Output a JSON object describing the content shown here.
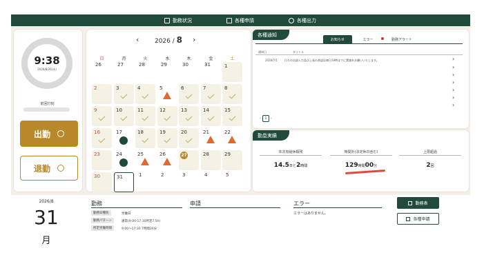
{
  "nav": {
    "items": [
      {
        "label": "勤務状況",
        "icon": "calendar-icon"
      },
      {
        "label": "各種申請",
        "icon": "document-icon"
      },
      {
        "label": "各種出力",
        "icon": "cloud-download-icon"
      }
    ]
  },
  "clock": {
    "time": "9:38",
    "date": "2026/8/26(水)"
  },
  "punch": {
    "last_label": "前回打刻",
    "in_label": "出勤",
    "out_label": "退勤"
  },
  "calendar": {
    "year_prefix": "2026 /",
    "month": "8",
    "weekdays": [
      "日",
      "月",
      "火",
      "水",
      "木",
      "金",
      "土"
    ],
    "rows": [
      [
        "26",
        "27",
        "28",
        "29",
        "30",
        "31",
        "1"
      ],
      [
        "2",
        "3",
        "4",
        "5",
        "6",
        "7",
        "8"
      ],
      [
        "9",
        "10",
        "11",
        "12",
        "13",
        "14",
        "15"
      ],
      [
        "16",
        "17",
        "18",
        "19",
        "20",
        "21",
        "22"
      ],
      [
        "23",
        "24",
        "25",
        "26",
        "27",
        "28",
        "29"
      ],
      [
        "30",
        "31",
        "1",
        "2",
        "3",
        "4",
        "5"
      ]
    ],
    "gold_badge": "27"
  },
  "notices": {
    "title": "各種通知",
    "tabs": [
      "お知らせ",
      "エラー",
      "勤務アラート"
    ],
    "col_date": "通知日",
    "col_title": "タイトル",
    "items": [
      {
        "date": "2026/7/1",
        "title": "日々の出退入力及び上長の承認は毎日19時までに実施をお願いいたします。"
      }
    ],
    "page": "1"
  },
  "attendance": {
    "title": "勤怠実績",
    "stats": [
      {
        "label": "年次有給休暇残",
        "num1": "14.5",
        "unit1": "日と",
        "num2": "2",
        "unit2": "時間"
      },
      {
        "label": "時間外(法定休日含む)",
        "num1": "129",
        "unit1": "時間",
        "num2": "00",
        "unit2": "分"
      },
      {
        "label": "上限超過",
        "num1": "2",
        "unit1": "回",
        "num2": "",
        "unit2": ""
      }
    ]
  },
  "day": {
    "ym": "2026/8",
    "day": "31",
    "weekday": "月"
  },
  "work": {
    "title": "勤務",
    "rows": [
      {
        "label": "勤務日種別",
        "value": "労働日"
      },
      {
        "label": "勤務パターン",
        "value": "通常(9:00-17:30所定7.5h)"
      },
      {
        "label": "所定労働時間",
        "value": "9:00〜17:30 7時間30分"
      }
    ]
  },
  "apply": {
    "title": "申請"
  },
  "error": {
    "title": "エラー",
    "text": "エラーはありません。"
  },
  "buttons": {
    "timesheet": "勤務表",
    "apply": "各種申請"
  },
  "colors": {
    "primary": "#1f4a3c",
    "accent": "#b8892b",
    "warning": "#e06a2c",
    "error_dot": "#e0302a"
  }
}
